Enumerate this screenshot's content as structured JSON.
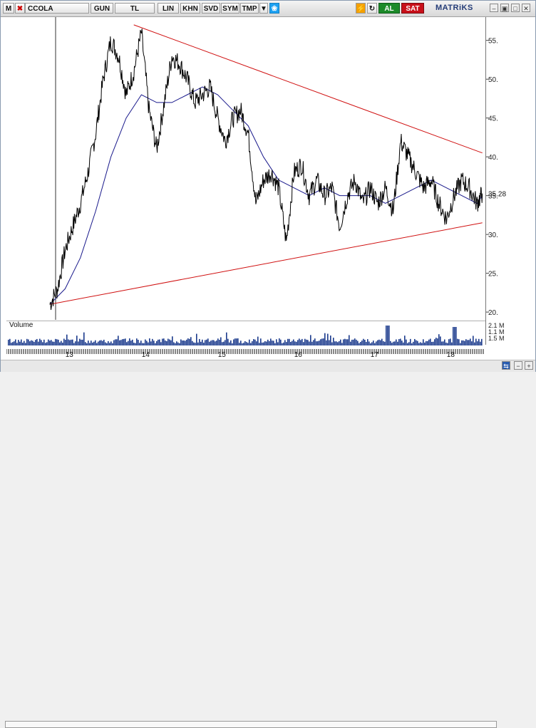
{
  "toolbar": {
    "m_label": "M",
    "symbol": "CCOLA",
    "buttons": [
      "GUN",
      "TL",
      "LIN",
      "KHN",
      "SVD",
      "SYM",
      "TMP"
    ],
    "al_label": "AL",
    "sat_label": "SAT",
    "brand": "MATRiKS"
  },
  "price_axis": {
    "ticks": [
      "55.",
      "50.",
      "45.",
      "40.",
      "35.",
      "30.",
      "25.",
      "20."
    ],
    "last_price": "35.28"
  },
  "volume": {
    "title": "Volume",
    "ticks": [
      "2.1 M",
      "1.1 M",
      "1.5 M"
    ]
  },
  "time_axis": {
    "ticks": [
      "13",
      "14",
      "15",
      "16",
      "17",
      "18"
    ]
  },
  "colors": {
    "price_line": "#000000",
    "moving_average": "#1a1a8c",
    "trendline": "#d01010",
    "volume_bars": "#1a3a8c"
  },
  "chart_data": {
    "type": "line",
    "x_ticks": [
      "13",
      "14",
      "15",
      "16",
      "17",
      "18"
    ],
    "ylim": [
      19,
      58
    ],
    "price": {
      "x": [
        12.75,
        12.85,
        12.95,
        13.05,
        13.15,
        13.25,
        13.35,
        13.45,
        13.55,
        13.65,
        13.75,
        13.85,
        13.95,
        14.05,
        14.15,
        14.25,
        14.35,
        14.45,
        14.55,
        14.65,
        14.75,
        14.85,
        14.95,
        15.05,
        15.15,
        15.25,
        15.35,
        15.45,
        15.55,
        15.65,
        15.75,
        15.85,
        15.95,
        16.05,
        16.15,
        16.25,
        16.35,
        16.45,
        16.55,
        16.65,
        16.75,
        16.85,
        16.95,
        17.05,
        17.15,
        17.25,
        17.35,
        17.45,
        17.55,
        17.65,
        17.75,
        17.85,
        17.95,
        18.05,
        18.15,
        18.25,
        18.35,
        18.42
      ],
      "y": [
        21,
        23,
        28,
        31,
        34,
        38,
        43,
        50,
        55,
        53,
        48,
        51,
        56,
        46,
        41,
        47,
        53,
        52,
        50,
        47,
        48,
        49,
        45,
        42,
        45,
        46,
        43,
        34,
        37,
        38,
        36,
        29,
        38,
        39,
        35,
        37,
        35,
        36,
        31,
        35,
        37,
        34,
        36,
        34,
        36,
        33,
        42,
        40,
        38,
        36,
        37,
        34,
        32,
        35,
        37,
        36,
        34,
        35.28
      ]
    },
    "moving_average": {
      "x": [
        12.75,
        12.95,
        13.15,
        13.35,
        13.55,
        13.75,
        13.95,
        14.15,
        14.35,
        14.55,
        14.75,
        14.95,
        15.15,
        15.35,
        15.55,
        15.75,
        15.95,
        16.15,
        16.35,
        16.55,
        16.75,
        16.95,
        17.15,
        17.35,
        17.55,
        17.75,
        17.95,
        18.15,
        18.35,
        18.42
      ],
      "y": [
        21,
        23,
        27,
        33,
        40,
        45,
        48,
        47,
        47,
        48,
        49,
        48,
        46,
        44,
        40,
        37,
        36,
        35,
        36,
        35,
        35,
        35,
        34,
        35,
        36,
        37,
        36,
        35,
        34,
        35
      ]
    },
    "trendlines": [
      {
        "x": [
          13.85,
          18.42
        ],
        "y": [
          57,
          40.5
        ]
      },
      {
        "x": [
          12.75,
          18.42
        ],
        "y": [
          21,
          31.5
        ]
      }
    ],
    "volume": {
      "ticks": [
        "2.1 M",
        "1.1 M",
        "1.5 M"
      ]
    }
  }
}
